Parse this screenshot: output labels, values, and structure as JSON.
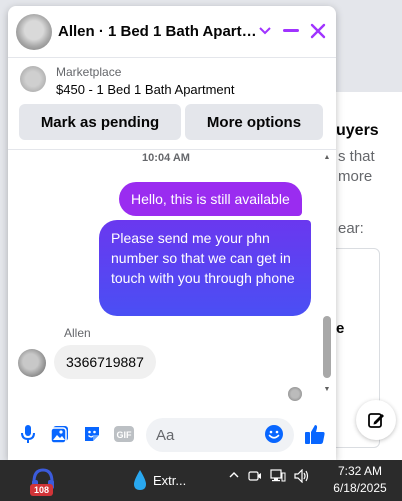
{
  "background": {
    "heading": "uyers",
    "line1": "s that",
    "line2": "more",
    "line3": "ear:",
    "letter": "e"
  },
  "chat": {
    "title": "Allen · 1 Bed 1 Bath Apartment",
    "listing": {
      "source": "Marketplace",
      "title": "$450 - 1 Bed 1 Bath Apartment",
      "mark_pending_label": "Mark as pending",
      "more_options_label": "More options"
    },
    "timestamp": "10:04 AM",
    "messages": [
      {
        "direction": "outgoing",
        "text": "Hello, this is still available"
      },
      {
        "direction": "outgoing",
        "text": "Please send me your phn number so that we can get in touch with you through phone"
      },
      {
        "direction": "incoming",
        "sender": "Allen",
        "text": "3366719887"
      }
    ],
    "composer": {
      "placeholder": "Aa"
    }
  },
  "taskbar": {
    "badge_count": "108",
    "extension_label": "Extr...",
    "time": "7:32 AM",
    "date": "6/18/2025"
  },
  "colors": {
    "accent": "#a033ff",
    "messenger_blue": "#0866ff",
    "outgoing_1": "#9a2cf0",
    "outgoing_2": "#4a4ff4"
  }
}
